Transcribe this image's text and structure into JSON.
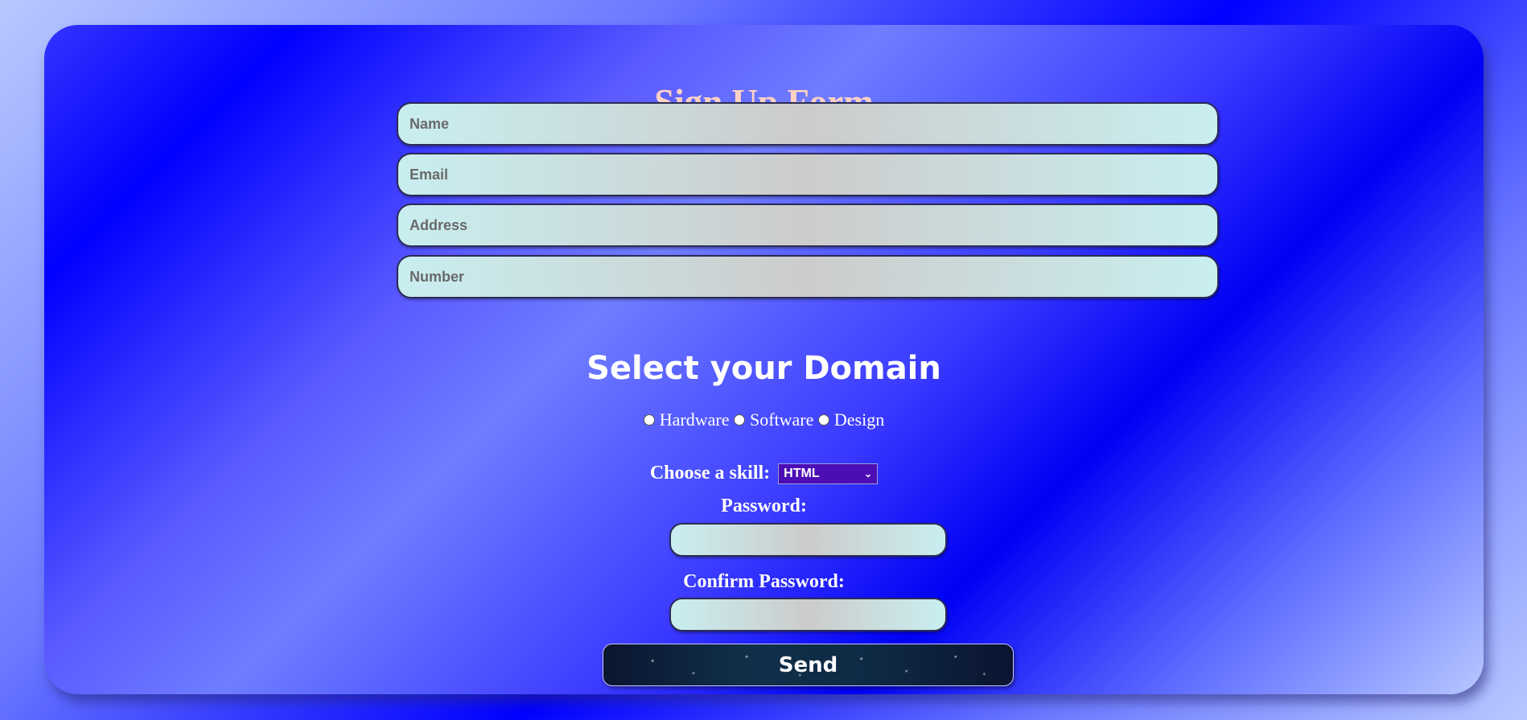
{
  "form": {
    "title": "Sign Up Form",
    "fields": [
      {
        "placeholder": "Name",
        "value": ""
      },
      {
        "placeholder": "Email",
        "value": ""
      },
      {
        "placeholder": "Address",
        "value": ""
      },
      {
        "placeholder": "Number",
        "value": ""
      }
    ],
    "domain_heading": "Select your Domain",
    "domains": [
      "Hardware",
      "Software",
      "Design"
    ],
    "skill_label": "Choose a skill:",
    "skill_selected": "HTML",
    "password_label": "Password:",
    "confirm_password_label": "Confirm Password:",
    "send_label": "Send"
  },
  "colors": {
    "title": "#ffd3c3",
    "select_background": "#4d0db5",
    "field_gradient": [
      "#c9eef0",
      "#cccccc"
    ]
  }
}
